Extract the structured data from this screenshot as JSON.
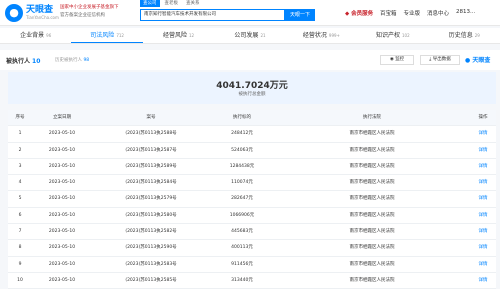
{
  "header": {
    "logo_name": "天眼查",
    "logo_url": "TianYanCha.com",
    "badge_line1": "国家中小企业发展子基金旗下",
    "badge_line2": "官方备案企业征信机构",
    "search_tabs": [
      "查公司",
      "查老板",
      "查关系"
    ],
    "search_value": "南京知行智能汽车技术开发有限公司",
    "search_button": "天眼一下",
    "vip": "会员服务",
    "nav": [
      "百宝箱",
      "专业版",
      "消息中心",
      "2813..."
    ]
  },
  "tabs": [
    {
      "label": "企业背景",
      "count": "96"
    },
    {
      "label": "司法风险",
      "count": "712"
    },
    {
      "label": "经营风险",
      "count": "12"
    },
    {
      "label": "公司发展",
      "count": "21"
    },
    {
      "label": "经营状况",
      "count": "999+"
    },
    {
      "label": "知识产权",
      "count": "102"
    },
    {
      "label": "历史信息",
      "count": "29"
    }
  ],
  "filter": {
    "title": "被执行人",
    "count": "10",
    "history_label": "历史被执行人",
    "history_count": "98",
    "monitor_label": "监控",
    "export_label": "导出数据",
    "brand": "天眼查"
  },
  "summary": {
    "amount": "4041.7024万元",
    "label": "被执行总金额"
  },
  "table": {
    "headers": [
      "序号",
      "立案日期",
      "案号",
      "执行标的",
      "执行法院",
      "操作"
    ],
    "rows": [
      [
        "1",
        "2023-05-10",
        "(2023)苏0113执2588号",
        "248412元",
        "南京市栖霞区人民法院",
        "详情"
      ],
      [
        "2",
        "2023-05-10",
        "(2023)苏0113执2587号",
        "524063元",
        "南京市栖霞区人民法院",
        "详情"
      ],
      [
        "3",
        "2023-05-10",
        "(2023)苏0113执2589号",
        "1284438元",
        "南京市栖霞区人民法院",
        "详情"
      ],
      [
        "4",
        "2023-05-10",
        "(2023)苏0113执2584号",
        "110074元",
        "南京市栖霞区人民法院",
        "详情"
      ],
      [
        "5",
        "2023-05-10",
        "(2023)苏0113执2579号",
        "282647元",
        "南京市栖霞区人民法院",
        "详情"
      ],
      [
        "6",
        "2023-05-10",
        "(2023)苏0113执2580号",
        "1066906元",
        "南京市栖霞区人民法院",
        "详情"
      ],
      [
        "7",
        "2023-05-10",
        "(2023)苏0113执2582号",
        "445683元",
        "南京市栖霞区人民法院",
        "详情"
      ],
      [
        "8",
        "2023-05-10",
        "(2023)苏0113执2590号",
        "400113元",
        "南京市栖霞区人民法院",
        "详情"
      ],
      [
        "9",
        "2023-05-10",
        "(2023)苏0113执2583号",
        "911456元",
        "南京市栖霞区人民法院",
        "详情"
      ],
      [
        "10",
        "2023-05-10",
        "(2023)苏0113执2585号",
        "313440元",
        "南京市栖霞区人民法院",
        "详情"
      ]
    ]
  }
}
